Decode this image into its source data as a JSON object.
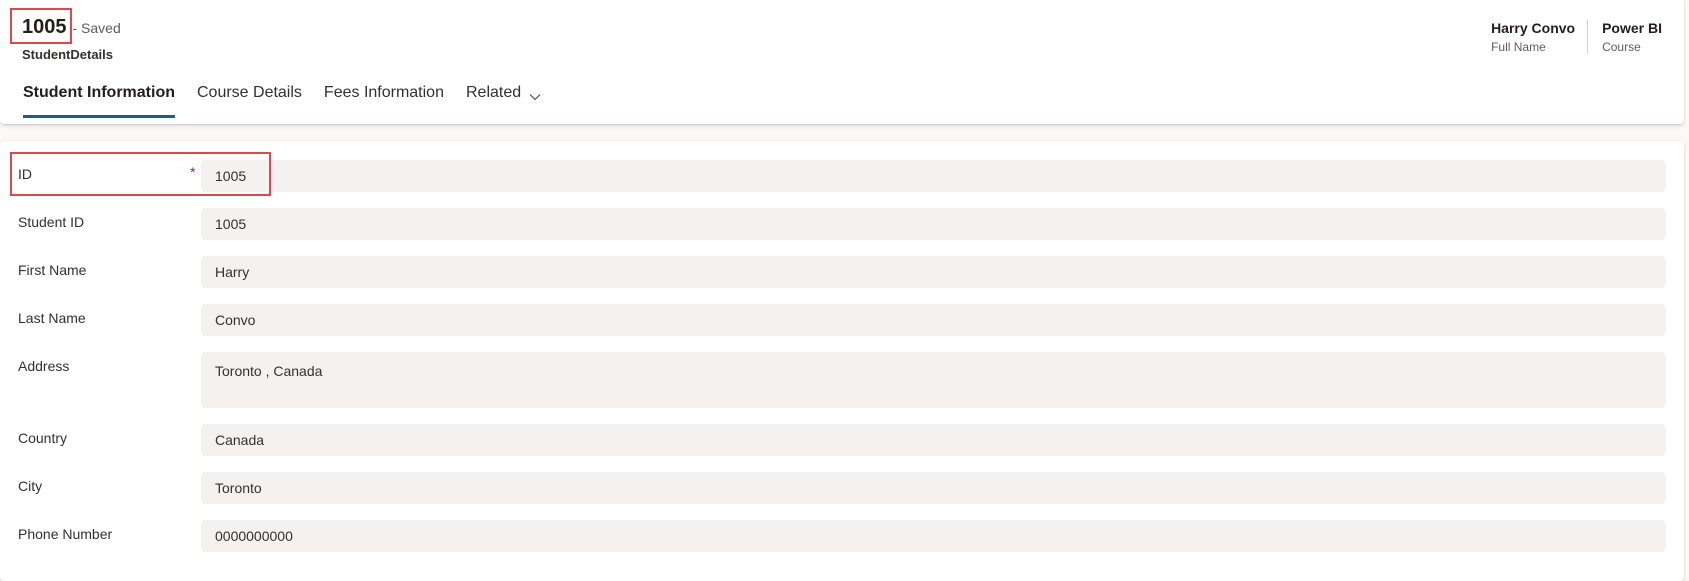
{
  "record": {
    "title": "1005",
    "saved_status": "- Saved",
    "entity_name": "StudentDetails"
  },
  "header_fields": [
    {
      "value": "Harry Convo",
      "label": "Full Name"
    },
    {
      "value": "Power BI",
      "label": "Course"
    }
  ],
  "tabs": [
    {
      "label": "Student Information",
      "active": true
    },
    {
      "label": "Course Details"
    },
    {
      "label": "Fees Information"
    },
    {
      "label": "Related",
      "icon": "chevron-down-icon"
    }
  ],
  "fields": [
    {
      "label": "ID",
      "value": "1005",
      "required": true,
      "required_mark": "*"
    },
    {
      "label": "Student ID",
      "value": "1005"
    },
    {
      "label": "First Name",
      "value": "Harry"
    },
    {
      "label": "Last Name",
      "value": "Convo"
    },
    {
      "label": "Address",
      "value": "Toronto , Canada",
      "multiline": true
    },
    {
      "label": "Country",
      "value": "Canada"
    },
    {
      "label": "City",
      "value": "Toronto"
    },
    {
      "label": "Phone Number",
      "value": "0000000000"
    }
  ],
  "colors": {
    "active_tab_underline": "#115ea3",
    "highlight_box": "#e0464e",
    "required_star": "#a4262c",
    "input_background": "#f3f2f1"
  }
}
